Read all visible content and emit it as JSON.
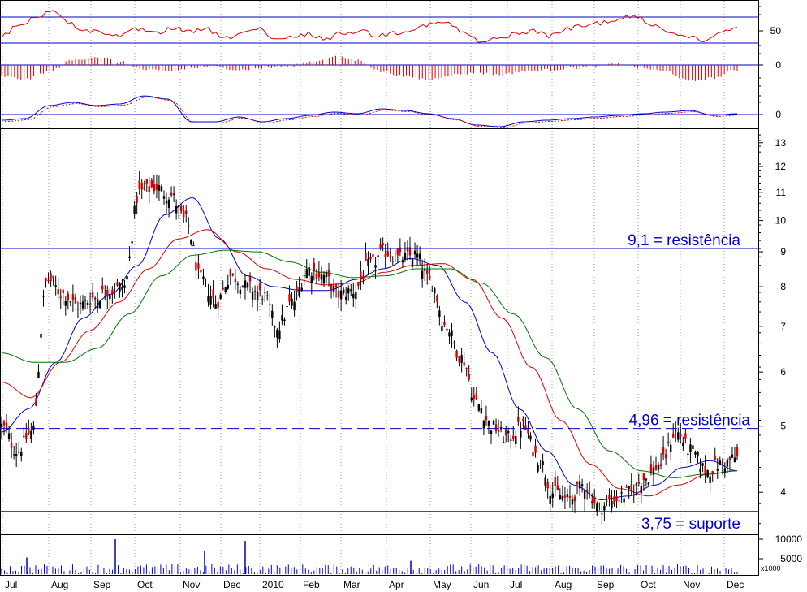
{
  "chart_data": {
    "type": "candlestick",
    "x_months": [
      "Jul",
      "Aug",
      "Sep",
      "Oct",
      "Nov",
      "Dec",
      "2010",
      "Feb",
      "Mar",
      "Apr",
      "May",
      "Jun",
      "Jul",
      "Aug",
      "Sep",
      "Oct",
      "Nov",
      "Dec"
    ],
    "price_axis": {
      "scale": "log",
      "ticks": [
        "13",
        "12",
        "11",
        "10",
        "9",
        "8",
        "7",
        "6",
        "5",
        "4"
      ],
      "range": [
        3.5,
        13.5
      ]
    },
    "indicator_ticks": {
      "rsi": [
        "50"
      ],
      "histogram": [
        "0"
      ],
      "oscillator": [
        "0"
      ]
    },
    "volume_axis": {
      "ticks": [
        "10000",
        "5000"
      ],
      "unit": "x1000"
    },
    "annotations": [
      {
        "text": "9,1 = resistência",
        "value": 9.1,
        "style": "solid"
      },
      {
        "text": "4,96 = resistência",
        "value": 4.96,
        "style": "dashed"
      },
      {
        "text": "3,75 = suporte",
        "value": 3.75,
        "style": "solid"
      }
    ],
    "price_series": {
      "name": "price",
      "approx_close_by_week": [
        5.0,
        4.6,
        4.9,
        8.2,
        7.8,
        7.5,
        7.7,
        7.9,
        8.0,
        11.0,
        11.2,
        10.9,
        10.0,
        8.2,
        7.6,
        8.3,
        8.0,
        7.8,
        7.0,
        7.6,
        8.5,
        8.3,
        7.8,
        7.9,
        8.6,
        9.0,
        8.8,
        8.9,
        8.1,
        7.0,
        6.3,
        5.4,
        5.0,
        4.8,
        5.0,
        4.5,
        4.0,
        3.9,
        4.1,
        3.8,
        3.9,
        4.0,
        4.2,
        4.4,
        4.9,
        4.6,
        4.3,
        4.4,
        4.5
      ]
    },
    "moving_averages": [
      {
        "color": "#0000cc",
        "approx_values": [
          4.9,
          5.3,
          6.2,
          7.2,
          7.8,
          8.6,
          10.2,
          10.8,
          9.4,
          8.3,
          8.0,
          7.9,
          7.9,
          8.2,
          8.5,
          8.8,
          8.6,
          7.6,
          6.4,
          5.3,
          4.6,
          4.1,
          3.9,
          3.95,
          4.1,
          4.35,
          4.45,
          4.3
        ]
      },
      {
        "color": "#dd0000",
        "approx_values": [
          5.8,
          5.5,
          6.2,
          6.9,
          7.6,
          8.5,
          9.4,
          9.7,
          9.0,
          8.5,
          8.2,
          8.05,
          8.1,
          8.4,
          8.6,
          8.65,
          8.2,
          7.2,
          6.1,
          5.1,
          4.4,
          4.05,
          3.95,
          4.1,
          4.25,
          4.3
        ]
      },
      {
        "color": "#007700",
        "approx_values": [
          6.4,
          6.2,
          6.2,
          6.5,
          7.3,
          8.3,
          8.9,
          9.05,
          9.0,
          8.7,
          8.4,
          8.25,
          8.3,
          8.5,
          8.5,
          8.1,
          7.3,
          6.3,
          5.3,
          4.6,
          4.3,
          4.2,
          4.25,
          4.3
        ]
      }
    ],
    "volume_spikes": [
      {
        "month_index": 0,
        "value": 5000
      },
      {
        "month_index": 2,
        "value": 10500
      },
      {
        "month_index": 4,
        "value": 7000
      },
      {
        "month_index": 5,
        "value": 10000
      },
      {
        "month_index": 9,
        "value": 4000
      }
    ]
  }
}
